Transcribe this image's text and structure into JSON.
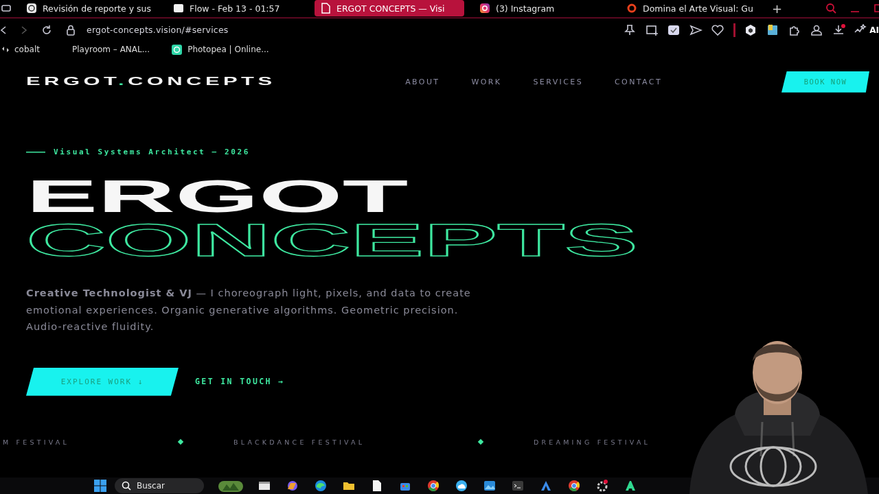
{
  "browser": {
    "tabs": [
      {
        "title": "Revisión de reporte y sus",
        "selected": false
      },
      {
        "title": "Flow - Feb 13 - 01:57",
        "selected": false
      },
      {
        "title": "ERGOT CONCEPTS — Visi",
        "selected": true
      },
      {
        "title": "(3) Instagram",
        "selected": false
      },
      {
        "title": "Domina el Arte Visual: Gu",
        "selected": false
      }
    ],
    "new_tab": "+",
    "address": "ergot-concepts.vision/#services",
    "ai_label": "AI",
    "bookmarks": [
      "cobalt",
      "Playroom – ANAL...",
      "Photopea | Online..."
    ]
  },
  "page": {
    "logo": {
      "before": "ERGOT",
      "dot": ".",
      "after": "CONCEPTS"
    },
    "nav": [
      {
        "label": "ABOUT"
      },
      {
        "label": "WORK"
      },
      {
        "label": "SERVICES"
      },
      {
        "label": "CONTACT"
      }
    ],
    "book_button": "BOOK NOW",
    "eyebrow": "Visual Systems Architect — 2026",
    "title_line_1": "ERGOT",
    "title_line_2": "CONCEPTS",
    "intro": "**Creative Technologist & VJ** — I choreograph light, pixels, and data to create emotional experiences. Organic generative algorithms. Geometric precision. Audio-reactive fluidity.",
    "primary_button": "EXPLORE WORK ↓",
    "secondary_button": "GET IN TOUCH →",
    "ticker": [
      "M FESTIVAL",
      "BLACKDANCE FESTIVAL",
      "DREAMING FESTIVAL"
    ]
  },
  "taskbar": {
    "search": {
      "placeholder": "Buscar"
    }
  }
}
